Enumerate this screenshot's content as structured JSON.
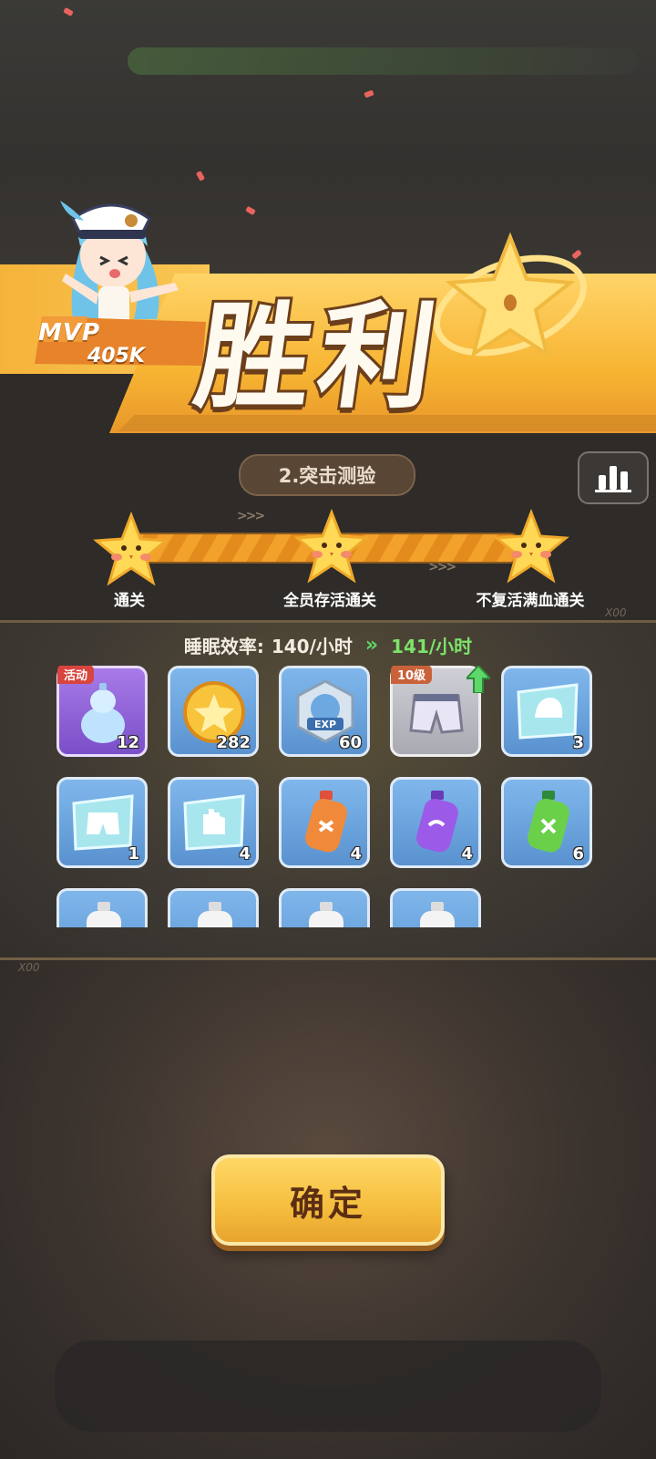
{
  "banner": {
    "mvp_label": "MVP",
    "mvp_score": "405K",
    "title": "胜利"
  },
  "level": {
    "name": "2.突击测验"
  },
  "objectives": [
    {
      "label": "通关"
    },
    {
      "label": "全员存活通关"
    },
    {
      "label": "不复活满血通关"
    }
  ],
  "efficiency": {
    "label": "睡眠效率:",
    "old": "140/小时",
    "new": "141/小时"
  },
  "rewards": [
    {
      "icon": "gourd-icon",
      "count": "12",
      "tag": "活动",
      "style": "purple"
    },
    {
      "icon": "gold-coin-icon",
      "count": "282",
      "tag": "",
      "style": "blue"
    },
    {
      "icon": "exp-badge-icon",
      "count": "60",
      "tag": "",
      "style": "blue"
    },
    {
      "icon": "shorts-icon",
      "count": "",
      "tag": "10级",
      "style": "grey"
    },
    {
      "icon": "helmet-blueprint-icon",
      "count": "3",
      "tag": "",
      "style": "blue"
    },
    {
      "icon": "shorts-blueprint-icon",
      "count": "1",
      "tag": "",
      "style": "blue"
    },
    {
      "icon": "glove-blueprint-icon",
      "count": "4",
      "tag": "",
      "style": "blue"
    },
    {
      "icon": "orange-bottle-icon",
      "count": "4",
      "tag": "",
      "style": "blue"
    },
    {
      "icon": "purple-bottle-icon",
      "count": "4",
      "tag": "",
      "style": "blue"
    },
    {
      "icon": "green-bottle-icon",
      "count": "6",
      "tag": "",
      "style": "blue"
    },
    {
      "icon": "bottle-icon",
      "count": "",
      "tag": "",
      "style": "blue"
    },
    {
      "icon": "bottle-icon",
      "count": "",
      "tag": "",
      "style": "blue"
    },
    {
      "icon": "bottle-icon",
      "count": "",
      "tag": "",
      "style": "blue"
    },
    {
      "icon": "bottle-icon",
      "count": "",
      "tag": "",
      "style": "blue"
    }
  ],
  "confirm": {
    "label": "确定"
  },
  "colors": {
    "accent": "#f7b533",
    "progress": "#f2a12a",
    "efficiency_up": "#7de36b"
  }
}
